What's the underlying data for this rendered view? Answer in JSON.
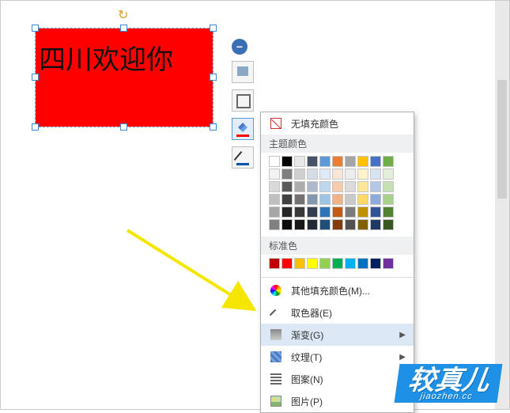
{
  "shape": {
    "text": "四川欢迎你"
  },
  "mini": {
    "collapse": "−",
    "btn_insert": "insert-image-icon",
    "btn_outline": "outline-icon",
    "btn_fill": "fill-bucket-icon",
    "btn_line": "pen-line-icon"
  },
  "popup": {
    "no_fill": "无填充颜色",
    "theme_header": "主题颜色",
    "standard_header": "标准色",
    "more_colors": "其他填充颜色(M)...",
    "eyedropper": "取色器(E)",
    "gradient": "渐变(G)",
    "texture": "纹理(T)",
    "pattern": "图案(N)",
    "picture": "图片(P)",
    "theme_colors": [
      [
        "#ffffff",
        "#000000",
        "#e8e8e8",
        "#445468",
        "#5b9bd5",
        "#ed7d31",
        "#a5a5a5",
        "#ffc000",
        "#4472c4",
        "#70ad47"
      ],
      [
        "#f2f2f2",
        "#7f7f7f",
        "#d0cece",
        "#d6dce5",
        "#deebf7",
        "#fbe5d6",
        "#ededed",
        "#fff2cc",
        "#d9e2f3",
        "#e2f0d9"
      ],
      [
        "#d9d9d9",
        "#595959",
        "#aeabab",
        "#adb9ca",
        "#bdd7ee",
        "#f8cbad",
        "#dbdbdb",
        "#ffe699",
        "#b4c7e7",
        "#c5e0b4"
      ],
      [
        "#bfbfbf",
        "#404040",
        "#757171",
        "#8497b0",
        "#9dc3e6",
        "#f4b183",
        "#c9c9c9",
        "#ffd966",
        "#8faadc",
        "#a9d18e"
      ],
      [
        "#a6a6a6",
        "#262626",
        "#3b3838",
        "#333f50",
        "#2e75b6",
        "#c55a11",
        "#7b7b7b",
        "#bf9000",
        "#2f5597",
        "#548235"
      ],
      [
        "#808080",
        "#0d0d0d",
        "#171717",
        "#222a35",
        "#1f4e79",
        "#843c0c",
        "#525252",
        "#806000",
        "#203864",
        "#385723"
      ]
    ],
    "standard_colors": [
      "#c00000",
      "#ff0000",
      "#ffc000",
      "#ffff00",
      "#92d050",
      "#00b050",
      "#00b0f0",
      "#0070c0",
      "#002060",
      "#7030a0"
    ]
  },
  "watermark": {
    "main": "较真儿",
    "sub": "jiaozhen.cc"
  }
}
